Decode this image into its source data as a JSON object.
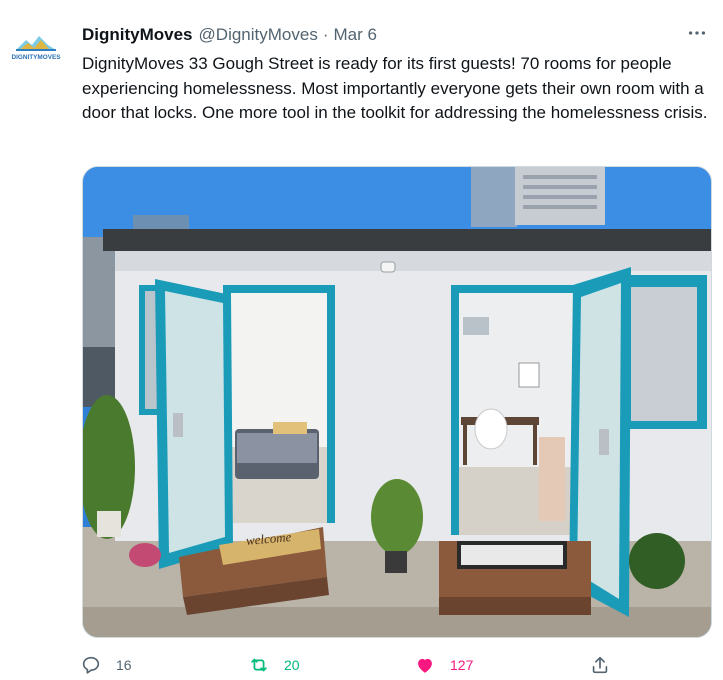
{
  "tweet": {
    "avatar_text": "DIGNITYMOVES",
    "display_name": "DignityMoves",
    "handle": "@DignityMoves",
    "separator": "·",
    "date": "Mar 6",
    "more_icon": "more-horizontal-icon",
    "text": "DignityMoves 33 Gough Street is ready for its first guests! 70 rooms for people experiencing homelessness.  Most importantly everyone gets their own room with a door that locks.  One more tool in the toolkit for addressing the homelessness crisis.",
    "media": {
      "doormat_text": "welcome"
    },
    "actions": {
      "reply": {
        "icon": "reply-icon",
        "count": "16"
      },
      "retweet": {
        "icon": "retweet-icon",
        "count": "20",
        "color": "#00ba7c"
      },
      "like": {
        "icon": "heart-filled-icon",
        "count": "127",
        "color": "#f91880"
      },
      "share": {
        "icon": "share-icon"
      }
    }
  }
}
